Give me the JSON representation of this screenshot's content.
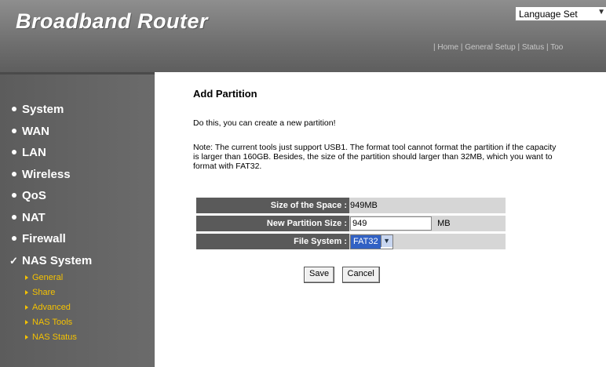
{
  "header": {
    "brand": "Broadband Router",
    "language_select": "Language Set",
    "nav": [
      "| Home",
      "| General Setup",
      "| Status",
      "| Too"
    ]
  },
  "sidebar": {
    "items": [
      {
        "label": "System"
      },
      {
        "label": "WAN"
      },
      {
        "label": "LAN"
      },
      {
        "label": "Wireless"
      },
      {
        "label": "QoS"
      },
      {
        "label": "NAT"
      },
      {
        "label": "Firewall"
      },
      {
        "label": "NAS System"
      }
    ],
    "subitems": [
      {
        "label": "General"
      },
      {
        "label": "Share"
      },
      {
        "label": "Advanced"
      },
      {
        "label": "NAS Tools"
      },
      {
        "label": "NAS Status"
      }
    ]
  },
  "main": {
    "title": "Add Partition",
    "intro": "Do this, you can create a new partition!",
    "note": "Note: The current tools just support USB1. The format tool cannot format the partition if the capacity is larger than 160GB. Besides, the size of the partition should larger than 32MB, which you want to format with FAT32.",
    "form": {
      "space_label": "Size of the Space :",
      "space_value": "949MB",
      "partition_label": "New Partition Size :",
      "partition_value": "949",
      "partition_unit": "MB",
      "fs_label": "File System :",
      "fs_value": "FAT32"
    },
    "save_label": "Save",
    "cancel_label": "Cancel"
  },
  "colors": {
    "header": "#7a7a7a",
    "sidebar": "#626262",
    "submenu_text": "#f5c200",
    "form_label_bg": "#5a5a5a",
    "form_value_bg": "#d6d6d6",
    "select_highlight": "#3161c4"
  },
  "icons": {
    "menu_bullet": "bullet-dot-icon",
    "active_menu": "checkmark-icon",
    "submenu_bullet": "triangle-right-icon",
    "dropdown": "chevron-down-icon"
  }
}
